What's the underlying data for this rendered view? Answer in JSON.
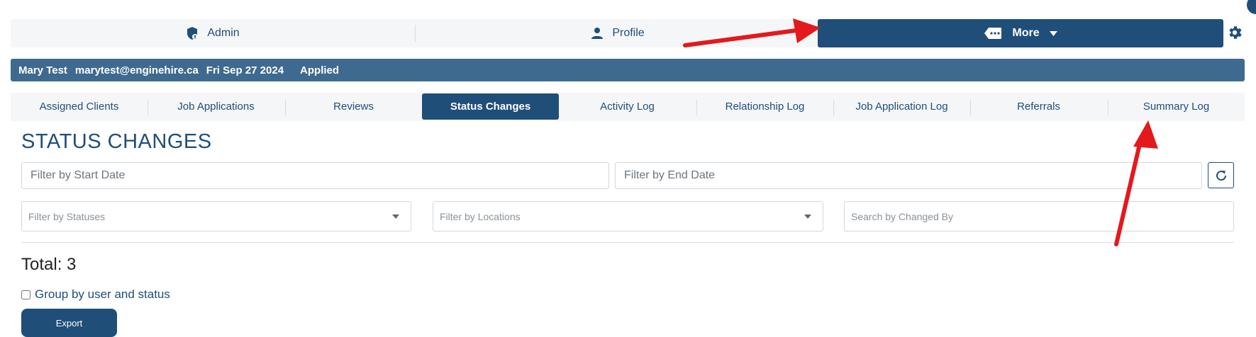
{
  "top_nav": {
    "admin_label": "Admin",
    "profile_label": "Profile",
    "more_label": "More"
  },
  "candidate": {
    "name": "Mary Test",
    "email": "marytest@enginehire.ca",
    "date": "Fri Sep 27 2024",
    "status": "Applied"
  },
  "tabs": [
    {
      "label": "Assigned Clients"
    },
    {
      "label": "Job Applications"
    },
    {
      "label": "Reviews"
    },
    {
      "label": "Status Changes",
      "active": true
    },
    {
      "label": "Activity Log"
    },
    {
      "label": "Relationship Log"
    },
    {
      "label": "Job Application Log"
    },
    {
      "label": "Referrals"
    },
    {
      "label": "Summary Log"
    }
  ],
  "page": {
    "title": "STATUS CHANGES",
    "start_date_placeholder": "Filter by Start Date",
    "end_date_placeholder": "Filter by End Date",
    "statuses_placeholder": "Filter by Statuses",
    "locations_placeholder": "Filter by Locations",
    "changed_by_placeholder": "Search by Changed By",
    "total_text": "Total: 3",
    "group_label": "Group by user and status",
    "export_label": "Export"
  },
  "colors": {
    "primary": "#1f4e79",
    "info_bar": "#3f6a8f",
    "annotation_arrow": "#e3191c"
  },
  "icons": [
    "shield-user-icon",
    "person-icon",
    "ticket-icon",
    "caret-down-icon",
    "gear-icon",
    "refresh-icon"
  ]
}
